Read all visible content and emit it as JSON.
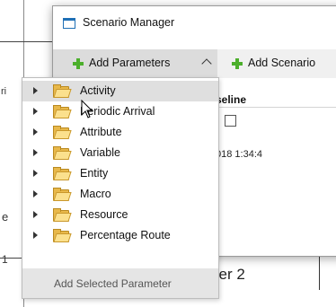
{
  "background": {
    "fragments": [
      "ri",
      "e",
      "1"
    ],
    "worker_label": "ker 2"
  },
  "window": {
    "title": "Scenario Manager",
    "toolbar": {
      "add_parameters_label": "Add Parameters",
      "add_scenario_label": "Add Scenario"
    },
    "grid": {
      "column_header": "seline",
      "date_cell": "018 1:34:4"
    }
  },
  "dropdown": {
    "items": [
      {
        "label": "Activity",
        "selected": true
      },
      {
        "label": "Periodic Arrival",
        "selected": false
      },
      {
        "label": "Attribute",
        "selected": false
      },
      {
        "label": "Variable",
        "selected": false
      },
      {
        "label": "Entity",
        "selected": false
      },
      {
        "label": "Macro",
        "selected": false
      },
      {
        "label": "Resource",
        "selected": false
      },
      {
        "label": "Percentage Route",
        "selected": false
      }
    ],
    "footer_label": "Add Selected Parameter"
  },
  "icons": {
    "window": "window-icon",
    "add": "plus-icon",
    "folder": "folder-icon",
    "expander": "expand-arrow-icon",
    "collapse": "caret-up-icon"
  },
  "colors": {
    "plus": "#4caf2c",
    "folder": "#e8b84a",
    "selection": "#dfdfdf",
    "toolbar_active": "#dcdcdc"
  }
}
